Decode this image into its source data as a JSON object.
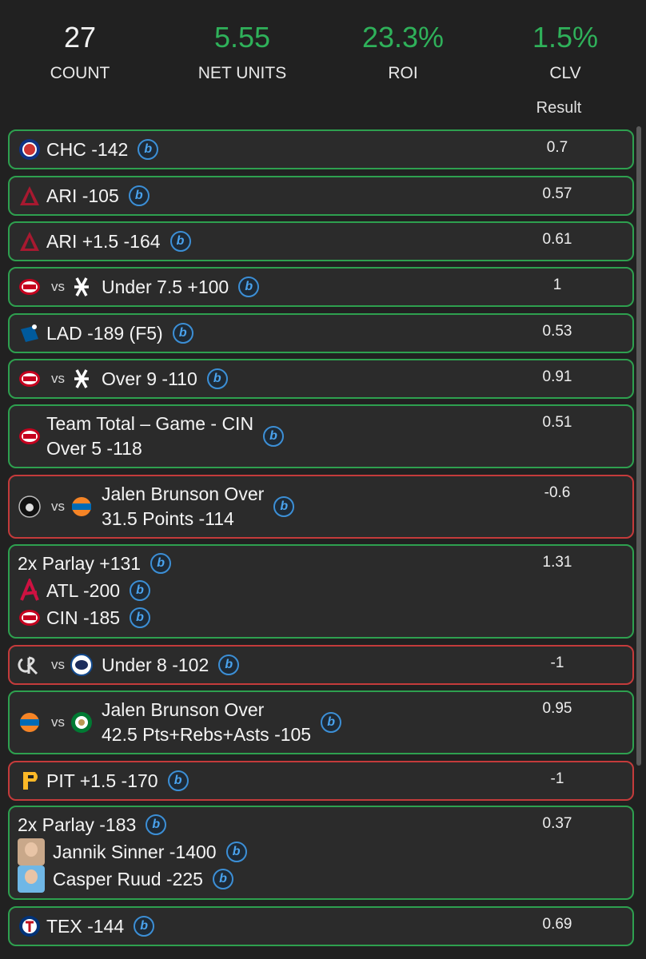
{
  "stats": [
    {
      "value": "27",
      "label": "COUNT",
      "color": "white"
    },
    {
      "value": "5.55",
      "label": "NET UNITS",
      "color": "green"
    },
    {
      "value": "23.3%",
      "label": "ROI",
      "color": "green"
    },
    {
      "value": "1.5%",
      "label": "CLV",
      "color": "green"
    }
  ],
  "result_header": "Result",
  "colors": {
    "win": "#2ea04f",
    "loss": "#c43b3b",
    "badge": "#3c8fd6"
  },
  "vs_label": "vs",
  "badge_letter": "b",
  "bets": [
    {
      "text": "CHC -142",
      "logos": [
        "cubs-logo"
      ],
      "result": "0.7",
      "outcome": "win"
    },
    {
      "text": "ARI -105",
      "logos": [
        "diamondbacks-logo"
      ],
      "result": "0.57",
      "outcome": "win"
    },
    {
      "text": "ARI +1.5 -164",
      "logos": [
        "diamondbacks-logo"
      ],
      "result": "0.61",
      "outcome": "win"
    },
    {
      "text": "Under 7.5 +100",
      "logos": [
        "reds-logo",
        "white-sox-logo"
      ],
      "result": "1",
      "outcome": "win"
    },
    {
      "text": "LAD -189 (F5)",
      "logos": [
        "dodgers-logo"
      ],
      "result": "0.53",
      "outcome": "win"
    },
    {
      "text": "Over 9 -110",
      "logos": [
        "reds-logo",
        "white-sox-logo"
      ],
      "result": "0.91",
      "outcome": "win"
    },
    {
      "text_lines": [
        "Team Total – Game - CIN",
        "Over 5 -118"
      ],
      "logos": [
        "reds-logo"
      ],
      "result": "0.51",
      "outcome": "win"
    },
    {
      "text_lines": [
        "Jalen Brunson Over",
        "31.5 Points -114"
      ],
      "logos": [
        "nets-logo",
        "knicks-logo"
      ],
      "result": "-0.6",
      "outcome": "loss"
    },
    {
      "parlay": "2x Parlay +131",
      "legs": [
        {
          "text": "ATL -200",
          "logo": "braves-logo"
        },
        {
          "text": "CIN -185",
          "logo": "reds-logo"
        }
      ],
      "result": "1.31",
      "outcome": "win"
    },
    {
      "text": "Under 8 -102",
      "logos": [
        "rockies-logo",
        "blue-jays-logo"
      ],
      "result": "-1",
      "outcome": "loss"
    },
    {
      "text_lines": [
        "Jalen Brunson Over",
        "42.5 Pts+Rebs+Asts -105"
      ],
      "logos": [
        "knicks-logo",
        "celtics-logo"
      ],
      "result": "0.95",
      "outcome": "win"
    },
    {
      "text": "PIT +1.5 -170",
      "logos": [
        "pirates-logo"
      ],
      "result": "-1",
      "outcome": "loss"
    },
    {
      "parlay": "2x Parlay -183",
      "legs": [
        {
          "text": "Jannik Sinner -1400",
          "logo": "sinner-avatar"
        },
        {
          "text": "Casper Ruud -225",
          "logo": "ruud-avatar"
        }
      ],
      "result": "0.37",
      "outcome": "win"
    },
    {
      "text": "TEX -144",
      "logos": [
        "rangers-logo"
      ],
      "result": "0.69",
      "outcome": "win"
    }
  ]
}
